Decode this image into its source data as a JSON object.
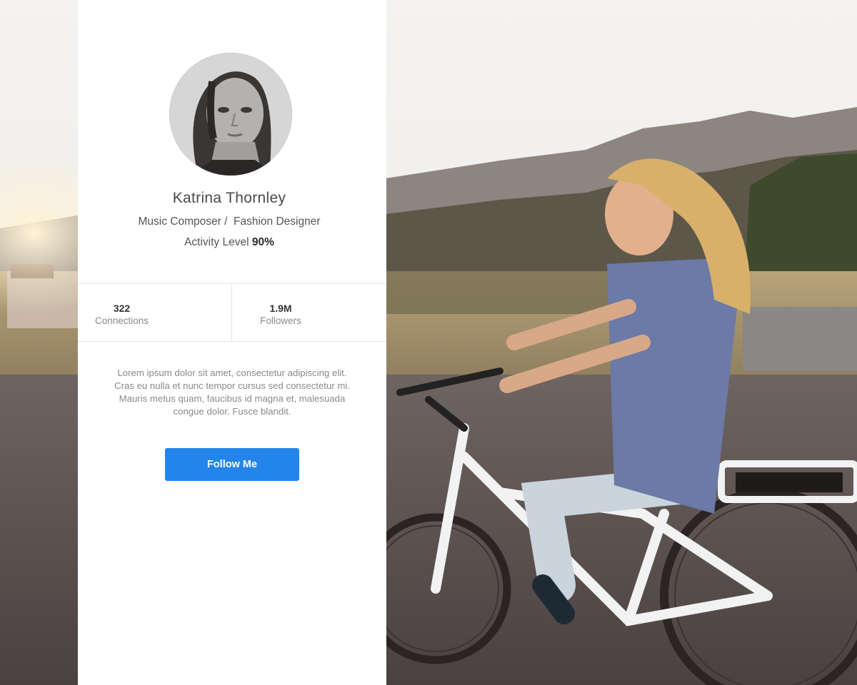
{
  "profile": {
    "name": "Katrina Thornley",
    "role": "Music Composer /  Fashion Designer",
    "activity_label": "Activity Level ",
    "activity_value": "90%",
    "activity_percent": 90
  },
  "stats": [
    {
      "value": "322",
      "label": "Connections"
    },
    {
      "value": "1.9M",
      "label": "Followers"
    }
  ],
  "bio": "Lorem ipsum dolor sit amet, consectetur adipiscing elit. Cras eu nulla et nunc tempor cursus sed consectetur mi. Mauris metus quam, faucibus id magna et, malesuada congue dolor. Fusce blandit.",
  "follow_button": {
    "label": "Follow Me",
    "color": "#2385ec"
  },
  "icons": {
    "avatar": "profile-photo",
    "background": "cycling-photo"
  }
}
